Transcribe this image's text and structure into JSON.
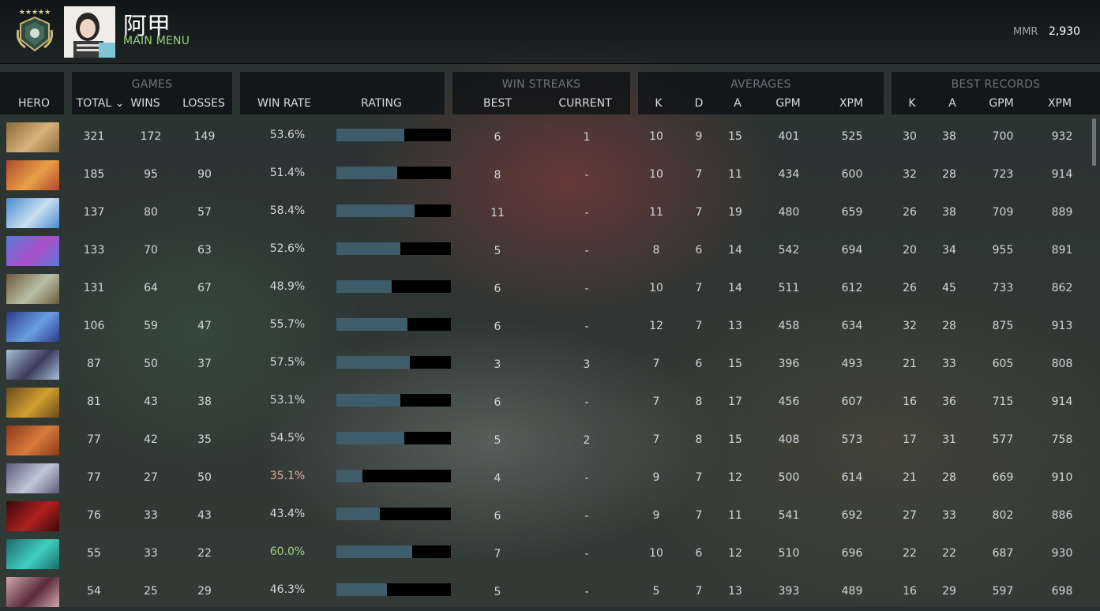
{
  "header": {
    "player_name": "阿甲",
    "main_menu_label": "MAIN MENU",
    "mmr_label": "MMR",
    "mmr_value": "2,930"
  },
  "table": {
    "group_titles": {
      "games": "GAMES",
      "win_streaks": "WIN STREAKS",
      "averages": "AVERAGES",
      "best_records": "BEST RECORDS"
    },
    "columns": {
      "hero": "HERO",
      "total": "TOTAL ⌄",
      "wins": "WINS",
      "losses": "LOSSES",
      "win_rate": "WIN RATE",
      "rating": "RATING",
      "best": "BEST",
      "current": "CURRENT",
      "avg_k": "K",
      "avg_d": "D",
      "avg_a": "A",
      "avg_gpm": "GPM",
      "avg_xpm": "XPM",
      "best_k": "K",
      "best_a": "A",
      "best_gpm": "GPM",
      "best_xpm": "XPM"
    },
    "colors": {
      "winrate_normal": "#d3d7d9",
      "winrate_low": "#e8a9a0",
      "winrate_high": "#9fd47f",
      "rating_fill": "#3f5c6b",
      "rating_bg": "#000000"
    },
    "rows": [
      {
        "hero_icon": "hero-portrait-1-icon",
        "total": "321",
        "wins": "172",
        "losses": "149",
        "win_rate": "53.6%",
        "rating": 0.59,
        "best": "6",
        "current": "1",
        "k": "10",
        "d": "9",
        "a": "15",
        "gpm": "401",
        "xpm": "525",
        "bk": "30",
        "ba": "38",
        "bgpm": "700",
        "bxpm": "932"
      },
      {
        "hero_icon": "hero-portrait-2-icon",
        "total": "185",
        "wins": "95",
        "losses": "90",
        "win_rate": "51.4%",
        "rating": 0.53,
        "best": "8",
        "current": "-",
        "k": "10",
        "d": "7",
        "a": "11",
        "gpm": "434",
        "xpm": "600",
        "bk": "32",
        "ba": "28",
        "bgpm": "723",
        "bxpm": "914"
      },
      {
        "hero_icon": "hero-portrait-3-icon",
        "total": "137",
        "wins": "80",
        "losses": "57",
        "win_rate": "58.4%",
        "rating": 0.68,
        "best": "11",
        "current": "-",
        "k": "11",
        "d": "7",
        "a": "19",
        "gpm": "480",
        "xpm": "659",
        "bk": "26",
        "ba": "38",
        "bgpm": "709",
        "bxpm": "889"
      },
      {
        "hero_icon": "hero-portrait-4-icon",
        "total": "133",
        "wins": "70",
        "losses": "63",
        "win_rate": "52.6%",
        "rating": 0.56,
        "best": "5",
        "current": "-",
        "k": "8",
        "d": "6",
        "a": "14",
        "gpm": "542",
        "xpm": "694",
        "bk": "20",
        "ba": "34",
        "bgpm": "955",
        "bxpm": "891"
      },
      {
        "hero_icon": "hero-portrait-5-icon",
        "total": "131",
        "wins": "64",
        "losses": "67",
        "win_rate": "48.9%",
        "rating": 0.48,
        "best": "6",
        "current": "-",
        "k": "10",
        "d": "7",
        "a": "14",
        "gpm": "511",
        "xpm": "612",
        "bk": "26",
        "ba": "45",
        "bgpm": "733",
        "bxpm": "862"
      },
      {
        "hero_icon": "hero-portrait-6-icon",
        "total": "106",
        "wins": "59",
        "losses": "47",
        "win_rate": "55.7%",
        "rating": 0.62,
        "best": "6",
        "current": "-",
        "k": "12",
        "d": "7",
        "a": "13",
        "gpm": "458",
        "xpm": "634",
        "bk": "32",
        "ba": "28",
        "bgpm": "875",
        "bxpm": "913"
      },
      {
        "hero_icon": "hero-portrait-7-icon",
        "total": "87",
        "wins": "50",
        "losses": "37",
        "win_rate": "57.5%",
        "rating": 0.64,
        "best": "3",
        "current": "3",
        "k": "7",
        "d": "6",
        "a": "15",
        "gpm": "396",
        "xpm": "493",
        "bk": "21",
        "ba": "33",
        "bgpm": "605",
        "bxpm": "808"
      },
      {
        "hero_icon": "hero-portrait-8-icon",
        "total": "81",
        "wins": "43",
        "losses": "38",
        "win_rate": "53.1%",
        "rating": 0.56,
        "best": "6",
        "current": "-",
        "k": "7",
        "d": "8",
        "a": "17",
        "gpm": "456",
        "xpm": "607",
        "bk": "16",
        "ba": "36",
        "bgpm": "715",
        "bxpm": "914"
      },
      {
        "hero_icon": "hero-portrait-9-icon",
        "total": "77",
        "wins": "42",
        "losses": "35",
        "win_rate": "54.5%",
        "rating": 0.59,
        "best": "5",
        "current": "2",
        "k": "7",
        "d": "8",
        "a": "15",
        "gpm": "408",
        "xpm": "573",
        "bk": "17",
        "ba": "31",
        "bgpm": "577",
        "bxpm": "758"
      },
      {
        "hero_icon": "hero-portrait-10-icon",
        "total": "77",
        "wins": "27",
        "losses": "50",
        "win_rate": "35.1%",
        "rating": 0.23,
        "best": "4",
        "current": "-",
        "k": "9",
        "d": "7",
        "a": "12",
        "gpm": "500",
        "xpm": "614",
        "bk": "21",
        "ba": "28",
        "bgpm": "669",
        "bxpm": "910"
      },
      {
        "hero_icon": "hero-portrait-11-icon",
        "total": "76",
        "wins": "33",
        "losses": "43",
        "win_rate": "43.4%",
        "rating": 0.38,
        "best": "6",
        "current": "-",
        "k": "9",
        "d": "7",
        "a": "11",
        "gpm": "541",
        "xpm": "692",
        "bk": "27",
        "ba": "33",
        "bgpm": "802",
        "bxpm": "886"
      },
      {
        "hero_icon": "hero-portrait-12-icon",
        "total": "55",
        "wins": "33",
        "losses": "22",
        "win_rate": "60.0%",
        "rating": 0.66,
        "best": "7",
        "current": "-",
        "k": "10",
        "d": "6",
        "a": "12",
        "gpm": "510",
        "xpm": "696",
        "bk": "22",
        "ba": "22",
        "bgpm": "687",
        "bxpm": "930"
      },
      {
        "hero_icon": "hero-portrait-13-icon",
        "total": "54",
        "wins": "25",
        "losses": "29",
        "win_rate": "46.3%",
        "rating": 0.44,
        "best": "5",
        "current": "-",
        "k": "5",
        "d": "7",
        "a": "13",
        "gpm": "393",
        "xpm": "489",
        "bk": "16",
        "ba": "29",
        "bgpm": "597",
        "bxpm": "698"
      }
    ]
  }
}
